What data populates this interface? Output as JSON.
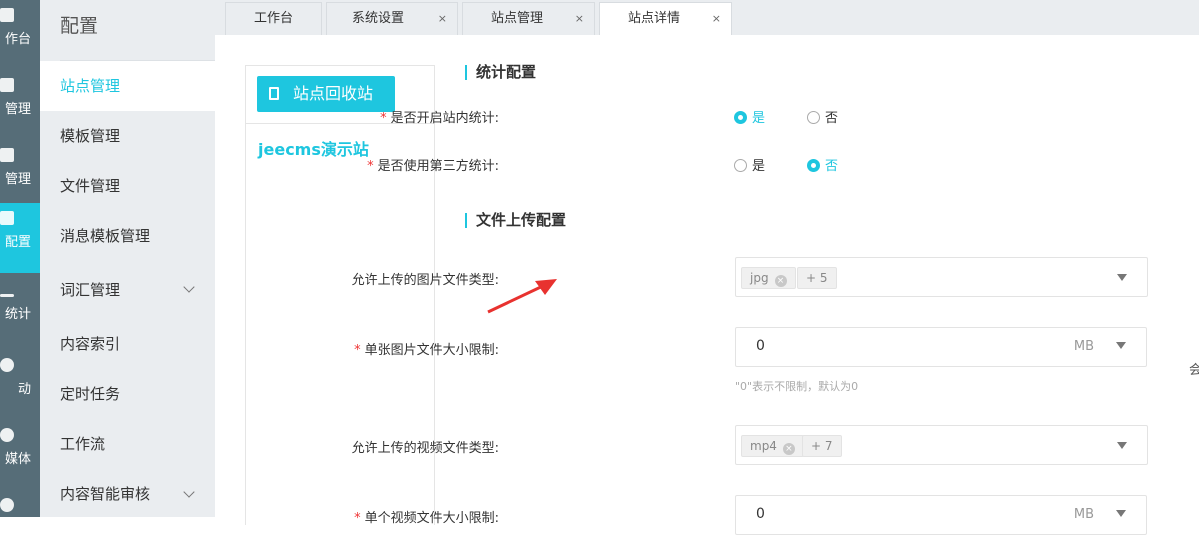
{
  "rail": [
    {
      "label": "作台"
    },
    {
      "label": "管理"
    },
    {
      "label": "管理"
    },
    {
      "label": "配置",
      "active": true
    },
    {
      "label": "统计"
    },
    {
      "label": "动"
    },
    {
      "label": "媒体"
    },
    {
      "label": ""
    }
  ],
  "submenu": {
    "title": "配置",
    "items": [
      {
        "label": "站点管理",
        "active": true
      },
      {
        "label": "模板管理"
      },
      {
        "label": "文件管理"
      },
      {
        "label": "消息模板管理"
      },
      {
        "label": "词汇管理",
        "expandable": true
      },
      {
        "label": "内容索引"
      },
      {
        "label": "定时任务"
      },
      {
        "label": "工作流"
      },
      {
        "label": "内容智能审核",
        "expandable": true
      }
    ]
  },
  "tabs": [
    {
      "label": "工作台"
    },
    {
      "label": "系统设置",
      "close": "×"
    },
    {
      "label": "站点管理",
      "close": "×"
    },
    {
      "label": "站点详情",
      "close": "×",
      "active": true
    }
  ],
  "sites": {
    "recycle_label": "站点回收站",
    "site_name": "jeecms演示站"
  },
  "form": {
    "section_stats": "统计配置",
    "enable_stats": {
      "label": "是否开启站内统计:",
      "options": [
        "是",
        "否"
      ],
      "selected": "是"
    },
    "third_party_stats": {
      "label": "是否使用第三方统计:",
      "options": [
        "是",
        "否"
      ],
      "selected": "否"
    },
    "section_upload": "文件上传配置",
    "image_types": {
      "label": "允许上传的图片文件类型:",
      "tag": "jpg",
      "more": "+ 5"
    },
    "image_size": {
      "label": "单张图片文件大小限制:",
      "value": "0",
      "unit": "MB",
      "hint": "\"0\"表示不限制，默认为0"
    },
    "video_types": {
      "label": "允许上传的视频文件类型:",
      "tag": "mp4",
      "more": "+ 7"
    },
    "video_size": {
      "label": "单个视频文件大小限制:",
      "value": "0",
      "unit": "MB"
    },
    "required_mark": "*"
  },
  "edge_text": "会",
  "colors": {
    "accent": "#1ec6df",
    "rail": "#566d78",
    "arrow": "#e8322f"
  }
}
